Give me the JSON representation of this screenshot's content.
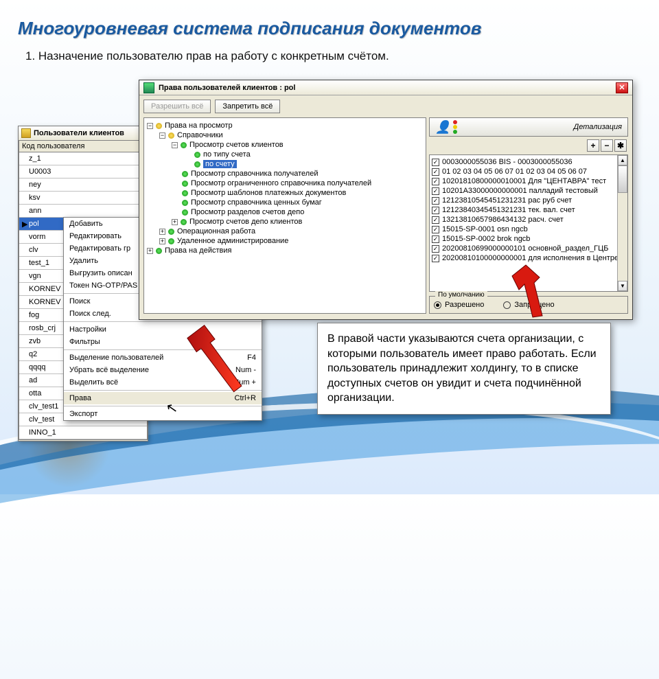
{
  "slide": {
    "title": "Многоуровневая система подписания документов",
    "subtitle": "1. Назначение пользователю прав на работу с конкретным счётом."
  },
  "users_window": {
    "title": "Пользователи клиентов",
    "column": "Код пользователя",
    "rows": [
      "z_1",
      "U0003",
      "ney",
      "ksv",
      "ann",
      "pol",
      "vorm",
      "clv",
      "test_1",
      "vgn",
      "KORNEV",
      "KORNEV",
      "fog",
      "rosb_crj",
      "zvb",
      "q2",
      "qqqq",
      "ad",
      "otta",
      "clv_test1",
      "clv_test",
      "INNO_1"
    ],
    "selected_index": 5
  },
  "context_menu": {
    "items": [
      {
        "label": "Добавить"
      },
      {
        "label": "Редактировать"
      },
      {
        "label": "Редактировать гр"
      },
      {
        "label": "Удалить"
      },
      {
        "label": "Выгрузить описан"
      },
      {
        "label": "Токен NG-OTP/PAS"
      },
      {
        "sep": true
      },
      {
        "label": "Поиск"
      },
      {
        "label": "Поиск след."
      },
      {
        "sep": true
      },
      {
        "label": "Настройки"
      },
      {
        "label": "Фильтры"
      },
      {
        "sep": true
      },
      {
        "label": "Выделение пользователей",
        "shortcut": "F4"
      },
      {
        "label": "Убрать всё выделение",
        "shortcut": "Num -"
      },
      {
        "label": "Выделить всё",
        "shortcut": "Num +"
      },
      {
        "sep": true
      },
      {
        "label": "Права",
        "shortcut": "Ctrl+R",
        "selected": true
      },
      {
        "sep": true
      },
      {
        "label": "Экспорт"
      }
    ]
  },
  "rights_window": {
    "title": "Права пользователей клиентов : pol",
    "allow_all": "Разрешить всё",
    "deny_all": "Запретить всё",
    "tree": [
      {
        "exp": "−",
        "dot": "y",
        "label": "Права на просмотр",
        "depth": 0
      },
      {
        "exp": "−",
        "dot": "y",
        "label": "Справочники",
        "depth": 1
      },
      {
        "exp": "−",
        "dot": "g",
        "label": "Просмотр счетов клиентов",
        "depth": 2
      },
      {
        "dot": "g",
        "label": "по типу счета",
        "depth": 3
      },
      {
        "dot": "g",
        "label": "по счету",
        "depth": 3,
        "selected": true
      },
      {
        "dot": "g",
        "label": "Просмотр справочника получателей",
        "depth": 2
      },
      {
        "dot": "g",
        "label": "Просмотр ограниченного справочника получателей",
        "depth": 2
      },
      {
        "dot": "g",
        "label": "Просмотр шаблонов платежных документов",
        "depth": 2
      },
      {
        "dot": "g",
        "label": "Просмотр справочника ценных бумаг",
        "depth": 2
      },
      {
        "dot": "g",
        "label": "Просмотр разделов счетов депо",
        "depth": 2
      },
      {
        "exp": "+",
        "dot": "g",
        "label": "Просмотр счетов депо клиентов",
        "depth": 2
      },
      {
        "exp": "+",
        "dot": "g",
        "label": "Операционная работа",
        "depth": 1
      },
      {
        "exp": "+",
        "dot": "g",
        "label": "Удаленное администрирование",
        "depth": 1
      },
      {
        "exp": "+",
        "dot": "g",
        "label": "Права на действия",
        "depth": 0
      }
    ],
    "detail_title": "Детализация",
    "tool_add": "+",
    "tool_remove": "−",
    "tool_all": "✱",
    "accounts": [
      "0003000055036 BIS - 0003000055036",
      "01 02 03 04 05 06 07 01 02 03 04 05 06 07",
      "10201810800000010001 Для \"ЦЕНТАВРА\" тест",
      "10201А33000000000001 палладий тестовый",
      "12123810545451231231 рас руб счет",
      "12123840345451321231 тек. вал. счет",
      "13213810657986434132 расч. счет",
      "15015-SP-0001 osn ngcb",
      "15015-SP-0002 brok ngcb",
      "20200810699000000101 основной_раздел_ГЦБ",
      "20200810100000000001 для исполнения в Центре"
    ],
    "default_group": "По умолчанию",
    "radio_allow": "Разрешено",
    "radio_deny": "Запрещено"
  },
  "note": "В правой части указываются счета организации, с которыми пользователь имеет право работать. Если пользователь принадлежит холдингу, то в списке доступных счетов он увидит и счета подчинённой организации."
}
